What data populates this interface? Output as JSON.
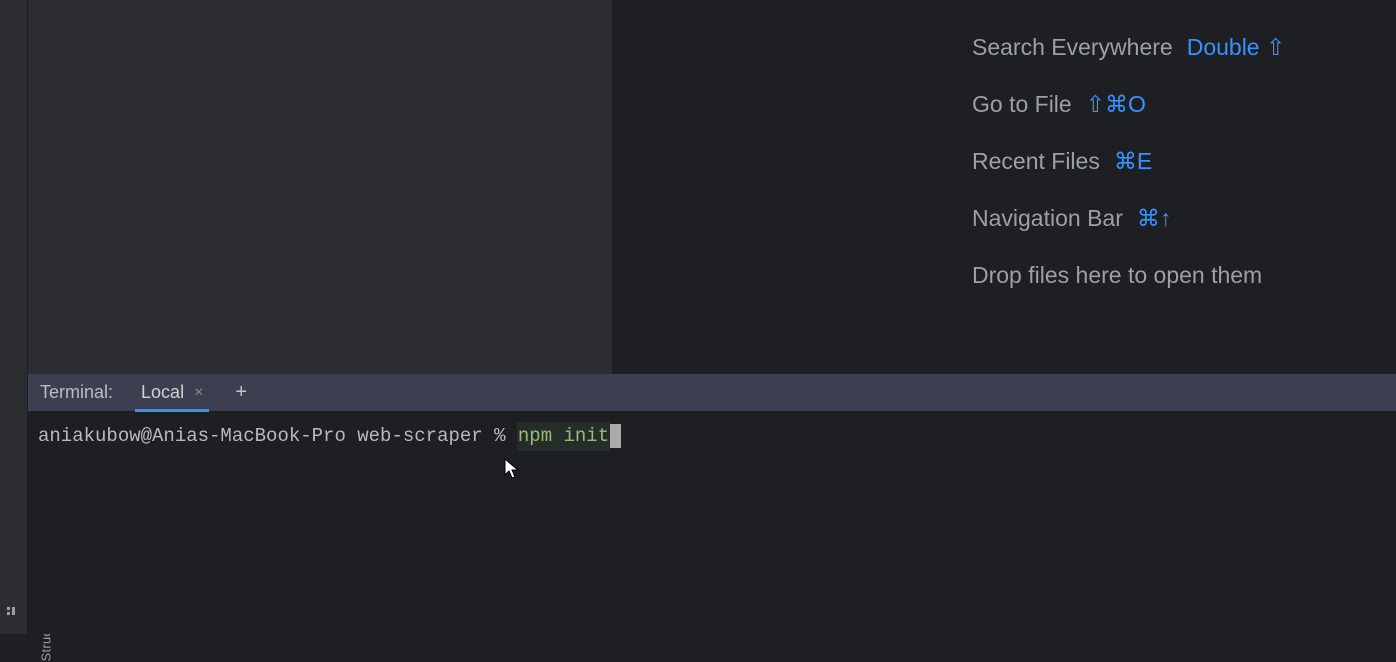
{
  "sidebar": {
    "structure_label": "Structure"
  },
  "welcome": {
    "actions": [
      {
        "label": "Search Everywhere",
        "shortcut_prefix": "Double",
        "shortcut": "⇧",
        "shortcut_style": "blue"
      },
      {
        "label": "Go to File",
        "shortcut": "⇧⌘O",
        "shortcut_style": "blue"
      },
      {
        "label": "Recent Files",
        "shortcut": "⌘E",
        "shortcut_style": "blue"
      },
      {
        "label": "Navigation Bar",
        "shortcut": "⌘↑",
        "shortcut_style": "blue"
      }
    ],
    "drop_text": "Drop files here to open them"
  },
  "terminal": {
    "title": "Terminal:",
    "tab_label": "Local",
    "prompt": "aniakubow@Anias-MacBook-Pro web-scraper % ",
    "command": "npm init"
  }
}
